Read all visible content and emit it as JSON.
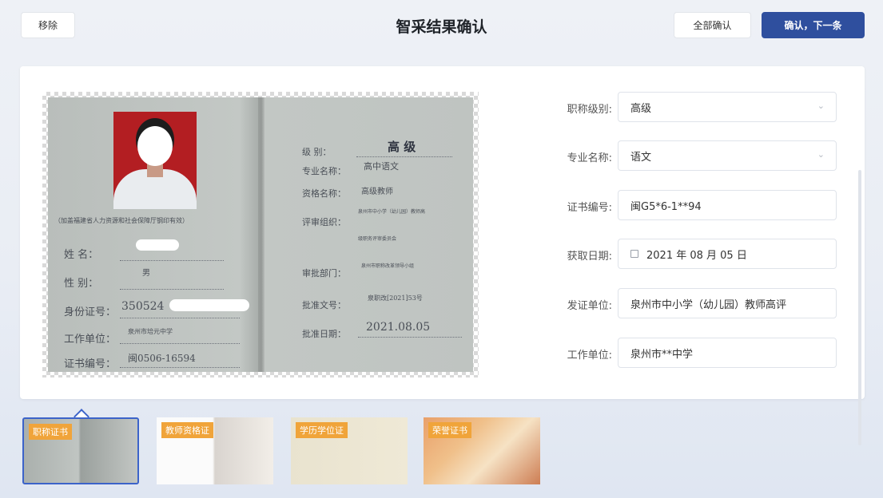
{
  "header": {
    "title": "智采结果确认",
    "remove_label": "移除",
    "confirm_all_label": "全部确认",
    "confirm_next_label": "确认，下一条"
  },
  "certificate": {
    "issuer_note": "（加盖福建省人力资源和社会保障厅钢印有效）",
    "left": {
      "name_label": "姓    名：",
      "gender_label": "性    别：",
      "gender_value": "男",
      "id_label": "身份证号：",
      "id_value": "350524",
      "work_label": "工作单位：",
      "work_value": "泉州市培元中学",
      "cert_label": "证书编号：",
      "cert_value": "闽0506-16594"
    },
    "right": {
      "level_label": "级    别：",
      "level_value": "高 级",
      "major_label": "专业名称：",
      "major_value": "高中语文",
      "qual_label": "资格名称：",
      "qual_value": "高级教师",
      "committee_label": "评审组织：",
      "committee_value1": "泉州市中小学（幼儿园）教师高",
      "committee_value2": "级职务评审委员会",
      "approve_dept_label": "审批部门：",
      "approve_dept_value": "泉州市职称改革领导小组",
      "approve_doc_label": "批准文号：",
      "approve_doc_value": "泉职改[2021]53号",
      "approve_date_label": "批准日期：",
      "approve_date_value": "2021.08.05"
    }
  },
  "form": {
    "fields": [
      {
        "label": "职称级别:",
        "value": "高级",
        "type": "select"
      },
      {
        "label": "专业名称:",
        "value": "语文",
        "type": "select"
      },
      {
        "label": "证书编号:",
        "value": "闽G5*6-1**94",
        "type": "text"
      },
      {
        "label": "获取日期:",
        "value": "2021 年 08 月 05 日",
        "type": "date"
      },
      {
        "label": "发证单位:",
        "value": "泉州市中小学（幼儿园）教师高评",
        "type": "text"
      },
      {
        "label": "工作单位:",
        "value": "泉州市**中学",
        "type": "text"
      }
    ]
  },
  "thumbnails": [
    {
      "label": "职称证书",
      "selected": true
    },
    {
      "label": "教师资格证",
      "selected": false
    },
    {
      "label": "学历学位证",
      "selected": false
    },
    {
      "label": "荣誉证书",
      "selected": false
    }
  ]
}
